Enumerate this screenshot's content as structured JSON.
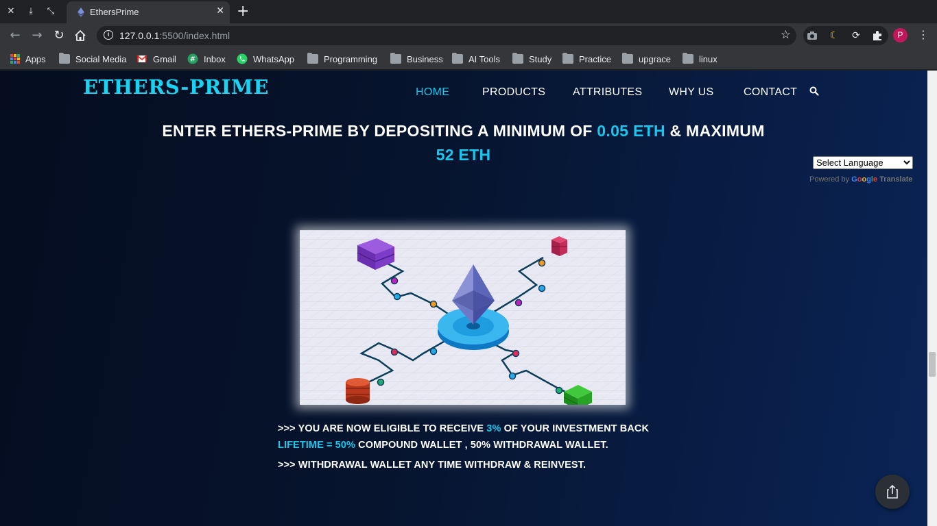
{
  "browser": {
    "tab_title": "EthersPrime",
    "url_host": "127.0.0.1",
    "url_rest": ":5500/index.html",
    "profile_initial": "P",
    "bookmarks": [
      {
        "label": "Apps",
        "icon": "apps-grid-icon"
      },
      {
        "label": "Social Media",
        "icon": "folder-icon"
      },
      {
        "label": "Gmail",
        "icon": "gmail-icon"
      },
      {
        "label": "Inbox",
        "icon": "inbox-icon"
      },
      {
        "label": "WhatsApp",
        "icon": "whatsapp-icon"
      },
      {
        "label": "Programming",
        "icon": "folder-icon"
      },
      {
        "label": "Business",
        "icon": "folder-icon"
      },
      {
        "label": "AI Tools",
        "icon": "folder-icon"
      },
      {
        "label": "Study",
        "icon": "folder-icon"
      },
      {
        "label": "Practice",
        "icon": "folder-icon"
      },
      {
        "label": "upgrace",
        "icon": "folder-icon"
      },
      {
        "label": "linux",
        "icon": "folder-icon"
      }
    ]
  },
  "site": {
    "logo": "ETHERS-PRIME",
    "nav": [
      {
        "label": "HOME",
        "active": true
      },
      {
        "label": "PRODUCTS",
        "active": false
      },
      {
        "label": "ATTRIBUTES",
        "active": false
      },
      {
        "label": "WHY US",
        "active": false
      },
      {
        "label": "CONTACT",
        "active": false
      }
    ],
    "headline": {
      "part1": "ENTER ETHERS-PRIME BY DEPOSITING A MINIMUM OF ",
      "min": "0.05 ETH",
      "part2": " & MAXIMUM",
      "max": "52 ETH"
    },
    "translate": {
      "select_label": "Select Language",
      "powered_by": "Powered by ",
      "google": "Google",
      "translate_word": "Translate"
    },
    "info": {
      "line1_a": ">>> YOU ARE NOW ELIGIBLE TO RECEIVE ",
      "line1_pct": "3%",
      "line1_b": " OF YOUR INVESTMENT BACK",
      "line2_a": "LIFETIME = 50%",
      "line2_b": " COMPOUND WALLET , 50% WITHDRAWAL WALLET.",
      "line3": ">>> WITHDRAWAL WALLET ANY TIME WITHDRAW & REINVEST."
    }
  },
  "colors": {
    "accent": "#19c6ee",
    "logo": "#19d3f0",
    "page_bg_dark": "#050d1f",
    "page_bg_light": "#0a2456"
  }
}
